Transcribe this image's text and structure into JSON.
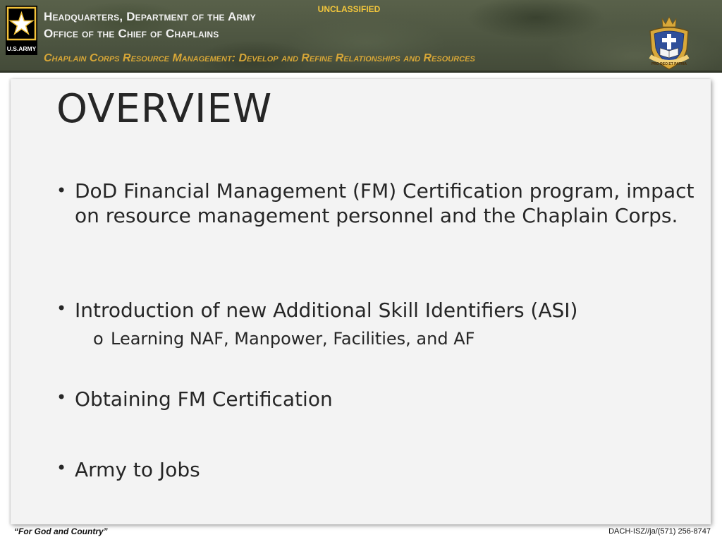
{
  "header": {
    "classification": "UNCLASSIFIED",
    "org_line1": "Headquarters, Department of the Army",
    "org_line2": "Office of the Chief of Chaplains",
    "subtitle": "Chaplain Corps Resource Management:  Develop and Refine Relationships and Resources",
    "army_logo_text": "U.S.ARMY",
    "crest_motto": "PRO DEO ET PATRIA",
    "colors": {
      "band": "#4c5440",
      "subtitle": "#d6a637",
      "classification": "#f2c63c"
    }
  },
  "slide": {
    "title": "OVERVIEW",
    "bullets": [
      {
        "text": "DoD Financial Management (FM) Certification program, impact on resource management personnel and the Chaplain Corps."
      },
      {
        "text": "Introduction of new Additional Skill Identifiers (ASI)",
        "sub": [
          "Learning NAF, Manpower, Facilities, and AF"
        ]
      },
      {
        "text": "Obtaining FM Certification"
      },
      {
        "text": "Army to Jobs"
      }
    ],
    "bullet_glyph": "•",
    "sub_bullet_glyph": "o"
  },
  "footer": {
    "motto": "“For God and Country”",
    "ref": "DACH-ISZ//ja/(571) 256-8747"
  }
}
